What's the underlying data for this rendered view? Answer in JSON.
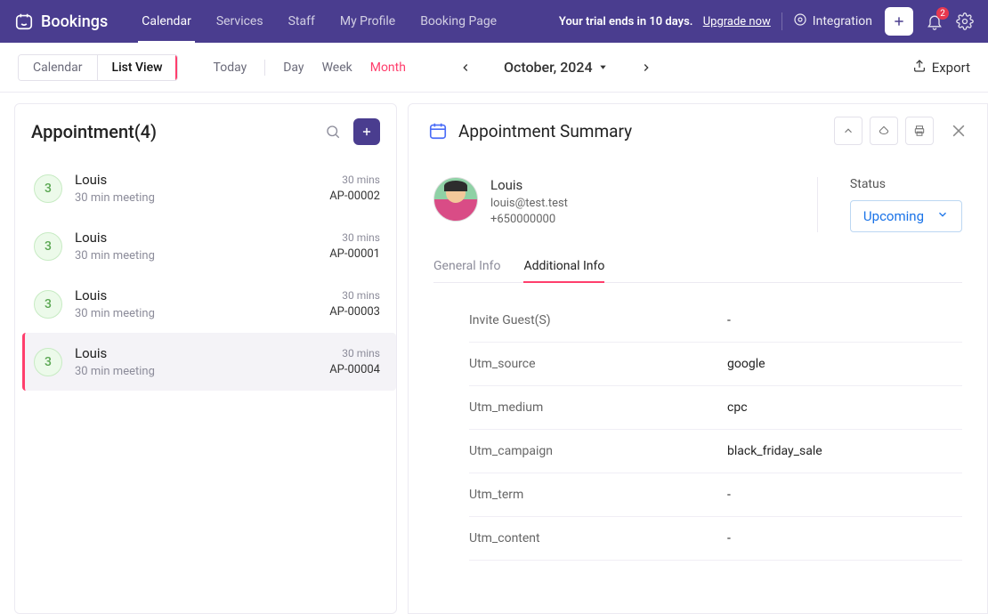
{
  "brand": "Bookings",
  "nav": {
    "items": [
      {
        "label": "Calendar",
        "active": true
      },
      {
        "label": "Services",
        "active": false
      },
      {
        "label": "Staff",
        "active": false
      },
      {
        "label": "My Profile",
        "active": false
      },
      {
        "label": "Booking Page",
        "active": false
      }
    ],
    "trial_prefix": "Your trial ends in 10 days.",
    "upgrade": "Upgrade now",
    "integration": "Integration",
    "notif_count": "2"
  },
  "subbar": {
    "view_calendar": "Calendar",
    "view_list": "List View",
    "today": "Today",
    "day": "Day",
    "week": "Week",
    "month": "Month",
    "current": "October, 2024",
    "export": "Export"
  },
  "left": {
    "title": "Appointment(4)",
    "items": [
      {
        "badge": "3",
        "name": "Louis",
        "desc": "30 min meeting",
        "dur": "30 mins",
        "id": "AP-00002",
        "active": false
      },
      {
        "badge": "3",
        "name": "Louis",
        "desc": "30 min meeting",
        "dur": "30 mins",
        "id": "AP-00001",
        "active": false
      },
      {
        "badge": "3",
        "name": "Louis",
        "desc": "30 min meeting",
        "dur": "30 mins",
        "id": "AP-00003",
        "active": false
      },
      {
        "badge": "3",
        "name": "Louis",
        "desc": "30 min meeting",
        "dur": "30 mins",
        "id": "AP-00004",
        "active": true
      }
    ]
  },
  "right": {
    "title": "Appointment Summary",
    "customer": {
      "name": "Louis",
      "email": "louis@test.test",
      "phone": "+650000000"
    },
    "status_label": "Status",
    "status_value": "Upcoming",
    "tabs": {
      "general": "General Info",
      "additional": "Additional Info"
    },
    "fields": [
      {
        "label": "Invite Guest(S)",
        "value": "-"
      },
      {
        "label": "Utm_source",
        "value": "google"
      },
      {
        "label": "Utm_medium",
        "value": "cpc"
      },
      {
        "label": "Utm_campaign",
        "value": "black_friday_sale"
      },
      {
        "label": "Utm_term",
        "value": "-"
      },
      {
        "label": "Utm_content",
        "value": "-"
      }
    ]
  }
}
